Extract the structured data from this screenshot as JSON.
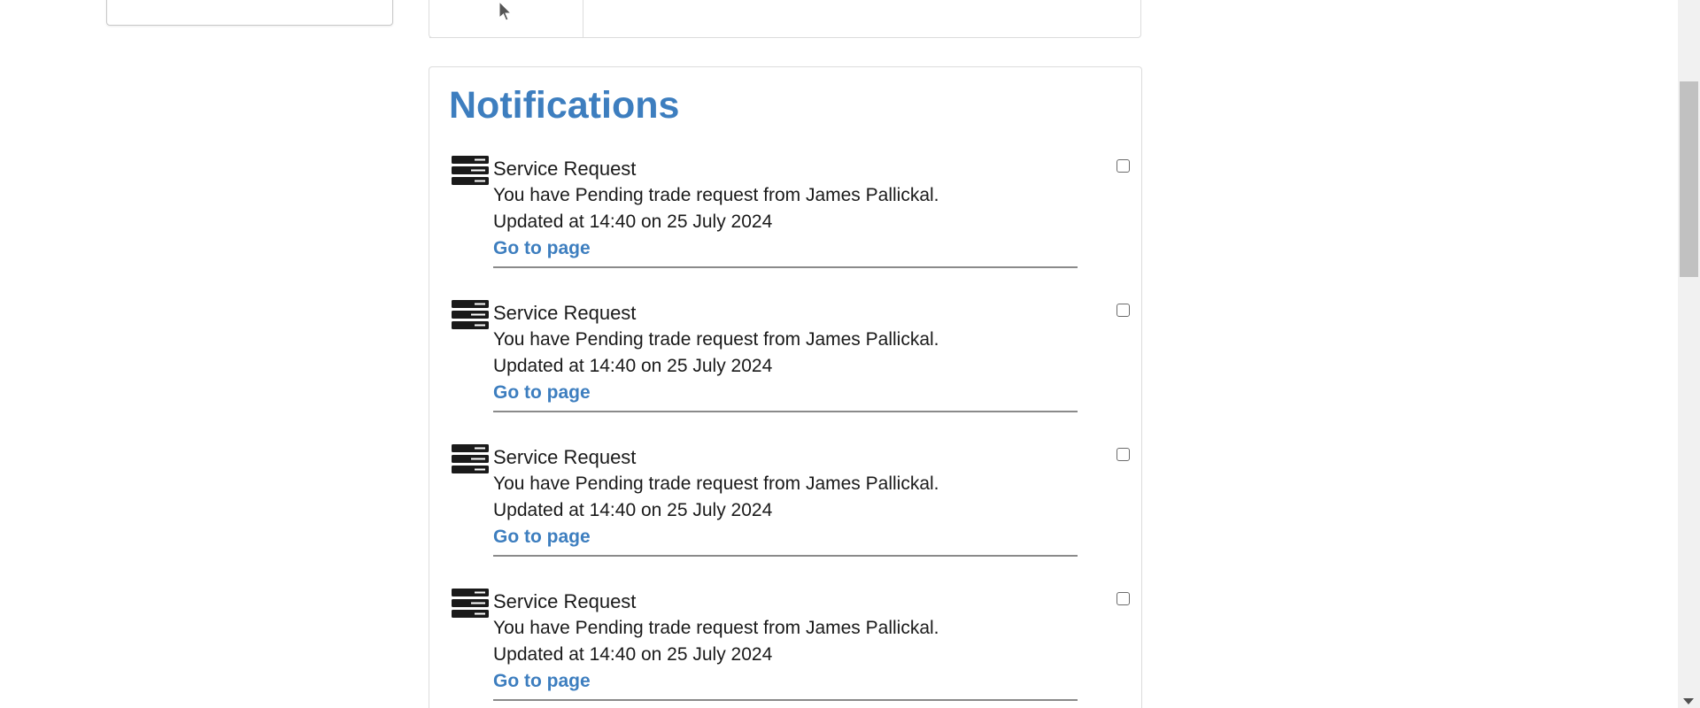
{
  "page": {
    "section_title": "Notifications"
  },
  "notifications": [
    {
      "icon": "server-icon",
      "title": "Service Request",
      "message": "You have Pending trade request from James Pallickal.",
      "updated": "Updated at 14:40 on 25 July 2024",
      "link": "Go to page"
    },
    {
      "icon": "server-icon",
      "title": "Service Request",
      "message": "You have Pending trade request from James Pallickal.",
      "updated": "Updated at 14:40 on 25 July 2024",
      "link": "Go to page"
    },
    {
      "icon": "server-icon",
      "title": "Service Request",
      "message": "You have Pending trade request from James Pallickal.",
      "updated": "Updated at 14:40 on 25 July 2024",
      "link": "Go to page"
    },
    {
      "icon": "server-icon",
      "title": "Service Request",
      "message": "You have Pending trade request from James Pallickal.",
      "updated": "Updated at 14:40 on 25 July 2024",
      "link": "Go to page"
    }
  ],
  "colors": {
    "accent": "#3d7ebf",
    "text": "#1a1a1a",
    "divider": "#8a8a8a"
  }
}
